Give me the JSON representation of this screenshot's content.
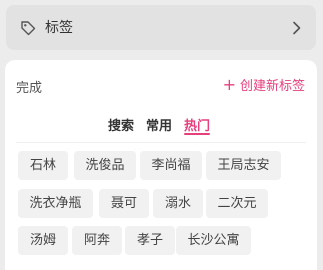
{
  "header": {
    "label": "标签",
    "icons": {
      "tag": "tag-icon",
      "chevron": "chevron-right-icon"
    }
  },
  "panel": {
    "done_label": "完成",
    "create_label": "创建新标签",
    "tabs": [
      {
        "label": "搜索",
        "active": false
      },
      {
        "label": "常用",
        "active": false
      },
      {
        "label": "热门",
        "active": true
      }
    ],
    "tags": [
      "石林",
      "洗俊品",
      "李尚福",
      "王局志安",
      "洗衣净瓶",
      "聂可",
      "溺水",
      "二次元",
      "汤姆",
      "阿奔",
      "孝子",
      "长沙公寓"
    ]
  },
  "colors": {
    "accent": "#e63f7c",
    "chip_bg": "#f1f1f1",
    "page_bg": "#ececec"
  }
}
